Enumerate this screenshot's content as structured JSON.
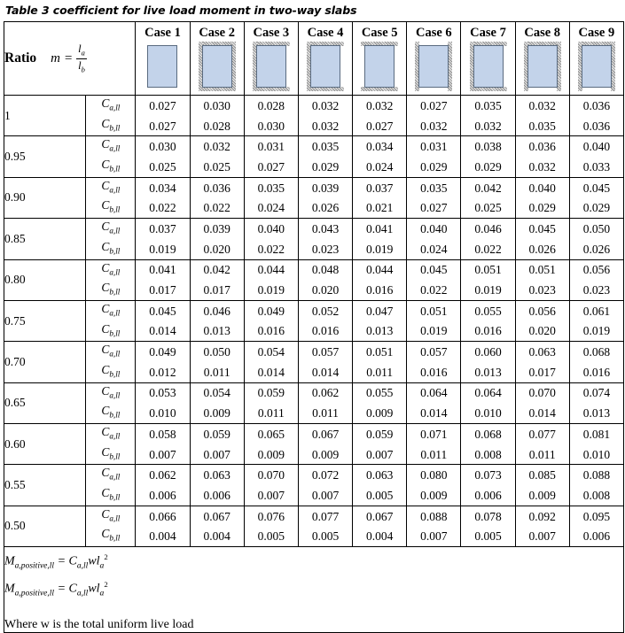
{
  "title": "Table 3 coefficient for live load moment in two-way slabs",
  "header": {
    "ratio_label": "Ratio",
    "m_symbol": "m",
    "equals": "=",
    "numerator": "l",
    "numerator_sub": "a",
    "denominator": "l",
    "denominator_sub": "b",
    "cases": [
      {
        "label": "Case 1",
        "hatch": []
      },
      {
        "label": "Case 2",
        "hatch": [
          "top",
          "bottom",
          "left",
          "right"
        ]
      },
      {
        "label": "Case 3",
        "hatch": [
          "top",
          "bottom",
          "left"
        ]
      },
      {
        "label": "Case 4",
        "hatch": [
          "top",
          "bottom",
          "left"
        ]
      },
      {
        "label": "Case 5",
        "hatch": [
          "top",
          "bottom"
        ]
      },
      {
        "label": "Case 6",
        "hatch": [
          "left",
          "right"
        ]
      },
      {
        "label": "Case 7",
        "hatch": [
          "top",
          "bottom",
          "left"
        ]
      },
      {
        "label": "Case 8",
        "hatch": [
          "top",
          "left",
          "right"
        ]
      },
      {
        "label": "Case 9",
        "hatch": [
          "top",
          "left",
          "right"
        ]
      }
    ]
  },
  "coef_labels": {
    "a": "C",
    "a_sub": "a,ll",
    "b": "C",
    "b_sub": "b,ll"
  },
  "rows": [
    {
      "ratio": "1",
      "ca": [
        "0.027",
        "0.030",
        "0.028",
        "0.032",
        "0.032",
        "0.027",
        "0.035",
        "0.032",
        "0.036"
      ],
      "cb": [
        "0.027",
        "0.028",
        "0.030",
        "0.032",
        "0.027",
        "0.032",
        "0.032",
        "0.035",
        "0.036"
      ]
    },
    {
      "ratio": "0.95",
      "ca": [
        "0.030",
        "0.032",
        "0.031",
        "0.035",
        "0.034",
        "0.031",
        "0.038",
        "0.036",
        "0.040"
      ],
      "cb": [
        "0.025",
        "0.025",
        "0.027",
        "0.029",
        "0.024",
        "0.029",
        "0.029",
        "0.032",
        "0.033"
      ]
    },
    {
      "ratio": "0.90",
      "ca": [
        "0.034",
        "0.036",
        "0.035",
        "0.039",
        "0.037",
        "0.035",
        "0.042",
        "0.040",
        "0.045"
      ],
      "cb": [
        "0.022",
        "0.022",
        "0.024",
        "0.026",
        "0.021",
        "0.027",
        "0.025",
        "0.029",
        "0.029"
      ]
    },
    {
      "ratio": "0.85",
      "ca": [
        "0.037",
        "0.039",
        "0.040",
        "0.043",
        "0.041",
        "0.040",
        "0.046",
        "0.045",
        "0.050"
      ],
      "cb": [
        "0.019",
        "0.020",
        "0.022",
        "0.023",
        "0.019",
        "0.024",
        "0.022",
        "0.026",
        "0.026"
      ]
    },
    {
      "ratio": "0.80",
      "ca": [
        "0.041",
        "0.042",
        "0.044",
        "0.048",
        "0.044",
        "0.045",
        "0.051",
        "0.051",
        "0.056"
      ],
      "cb": [
        "0.017",
        "0.017",
        "0.019",
        "0.020",
        "0.016",
        "0.022",
        "0.019",
        "0.023",
        "0.023"
      ]
    },
    {
      "ratio": "0.75",
      "ca": [
        "0.045",
        "0.046",
        "0.049",
        "0.052",
        "0.047",
        "0.051",
        "0.055",
        "0.056",
        "0.061"
      ],
      "cb": [
        "0.014",
        "0.013",
        "0.016",
        "0.016",
        "0.013",
        "0.019",
        "0.016",
        "0.020",
        "0.019"
      ]
    },
    {
      "ratio": "0.70",
      "ca": [
        "0.049",
        "0.050",
        "0.054",
        "0.057",
        "0.051",
        "0.057",
        "0.060",
        "0.063",
        "0.068"
      ],
      "cb": [
        "0.012",
        "0.011",
        "0.014",
        "0.014",
        "0.011",
        "0.016",
        "0.013",
        "0.017",
        "0.016"
      ]
    },
    {
      "ratio": "0.65",
      "ca": [
        "0.053",
        "0.054",
        "0.059",
        "0.062",
        "0.055",
        "0.064",
        "0.064",
        "0.070",
        "0.074"
      ],
      "cb": [
        "0.010",
        "0.009",
        "0.011",
        "0.011",
        "0.009",
        "0.014",
        "0.010",
        "0.014",
        "0.013"
      ]
    },
    {
      "ratio": "0.60",
      "ca": [
        "0.058",
        "0.059",
        "0.065",
        "0.067",
        "0.059",
        "0.071",
        "0.068",
        "0.077",
        "0.081"
      ],
      "cb": [
        "0.007",
        "0.007",
        "0.009",
        "0.009",
        "0.007",
        "0.011",
        "0.008",
        "0.011",
        "0.010"
      ]
    },
    {
      "ratio": "0.55",
      "ca": [
        "0.062",
        "0.063",
        "0.070",
        "0.072",
        "0.063",
        "0.080",
        "0.073",
        "0.085",
        "0.088"
      ],
      "cb": [
        "0.006",
        "0.006",
        "0.007",
        "0.007",
        "0.005",
        "0.009",
        "0.006",
        "0.009",
        "0.008"
      ]
    },
    {
      "ratio": "0.50",
      "ca": [
        "0.066",
        "0.067",
        "0.076",
        "0.077",
        "0.067",
        "0.088",
        "0.078",
        "0.092",
        "0.095"
      ],
      "cb": [
        "0.004",
        "0.004",
        "0.005",
        "0.005",
        "0.004",
        "0.007",
        "0.005",
        "0.007",
        "0.006"
      ]
    }
  ],
  "footer": {
    "formula1": {
      "lhs": "M",
      "lhs_sub": "a,positive,ll",
      "eq": "=",
      "coef": "C",
      "coef_sub": "a,ll",
      "w": "w",
      "l": "l",
      "l_sub": "a",
      "exp": "2"
    },
    "formula2": {
      "lhs": "M",
      "lhs_sub": "a,positive,ll",
      "eq": "=",
      "coef": "C",
      "coef_sub": "a,ll",
      "w": "w",
      "l": "l",
      "l_sub": "a",
      "exp": "2"
    },
    "note": "Where w is the total uniform live load"
  },
  "colors": {
    "slab_fill": "#c3d3ea",
    "slab_border": "#5a6b80",
    "hatch": "#8d8d8d",
    "grid": "#000000"
  }
}
